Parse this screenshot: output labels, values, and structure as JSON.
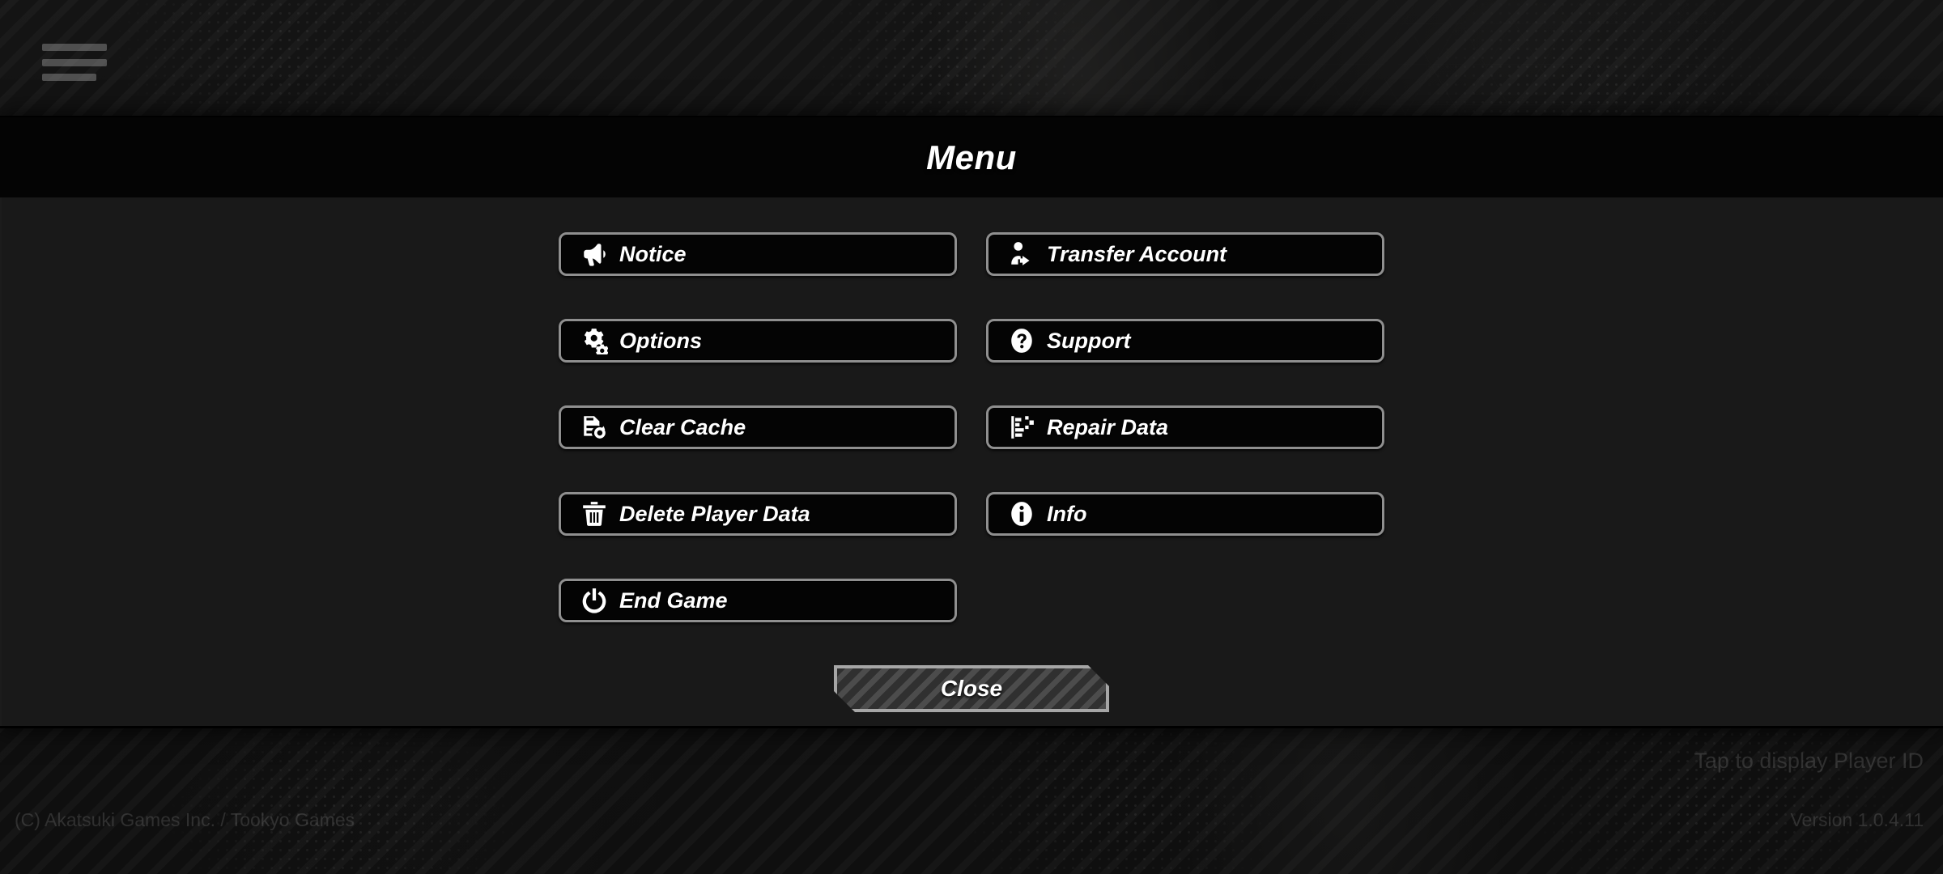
{
  "window": {
    "hamburger_icon": "hamburger-menu-icon"
  },
  "panel": {
    "title": "Menu"
  },
  "menu_items": [
    [
      {
        "label": "Notice",
        "icon": "megaphone-icon"
      },
      {
        "label": "Transfer Account",
        "icon": "account-transfer-icon"
      }
    ],
    [
      {
        "label": "Options",
        "icon": "gear-icon"
      },
      {
        "label": "Support",
        "icon": "question-mark-circle-icon"
      }
    ],
    [
      {
        "label": "Clear Cache",
        "icon": "document-refresh-icon"
      },
      {
        "label": "Repair Data",
        "icon": "data-repair-icon"
      }
    ],
    [
      {
        "label": "Delete Player Data",
        "icon": "trash-can-icon"
      },
      {
        "label": "Info",
        "icon": "info-circle-icon"
      }
    ],
    [
      {
        "label": "End Game",
        "icon": "power-icon"
      }
    ]
  ],
  "close": {
    "label": "Close"
  },
  "footer": {
    "copyright": "(C) Akatsuki Games Inc. / Tookyo Games",
    "player_id_hint": "Tap to display Player ID",
    "version": "Version 1.0.4.11"
  },
  "colors": {
    "panel_background": "#191919",
    "header_background": "#040404",
    "button_background": "#040404",
    "button_border": "#8f8f8f",
    "text": "#ffffff",
    "close_stripe_light": "#4c4c4c",
    "close_stripe_dark": "#303030",
    "close_border": "#a6a6a6"
  }
}
